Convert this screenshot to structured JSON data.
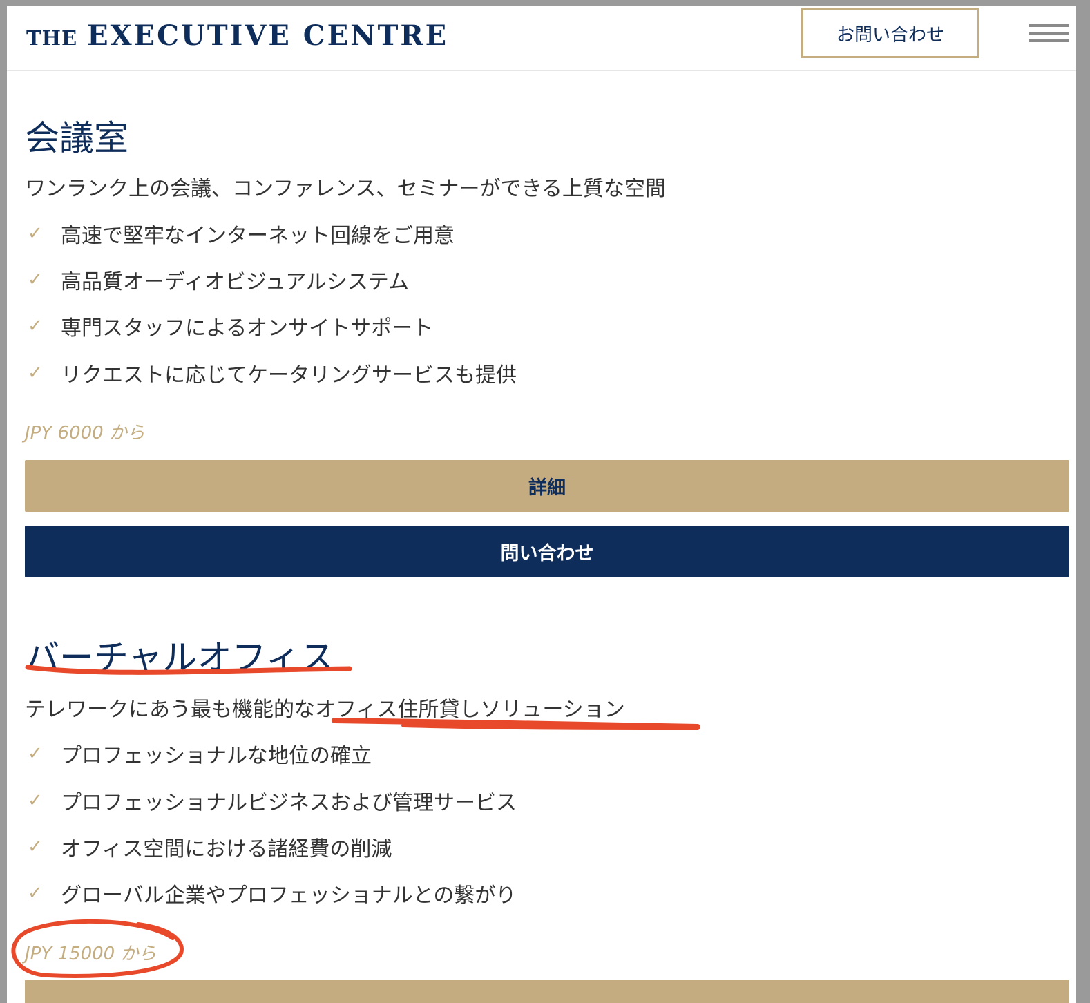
{
  "header": {
    "logo_the": "THE",
    "logo_main": "EXECUTIVE CENTRE",
    "contact_label": "お問い合わせ"
  },
  "meeting_room": {
    "title": "会議室",
    "subtitle": "ワンランク上の会議、コンファレンス、セミナーができる上質な空間",
    "features": [
      "高速で堅牢なインターネット回線をご用意",
      "高品質オーディオビジュアルシステム",
      "専門スタッフによるオンサイトサポート",
      "リクエストに応じてケータリングサービスも提供"
    ],
    "price": "JPY 6000 から",
    "detail_label": "詳細",
    "contact_label": "問い合わせ"
  },
  "virtual_office": {
    "title": "バーチャルオフィス",
    "subtitle": "テレワークにあう最も機能的なオフィス住所貸しソリューション",
    "features": [
      "プロフェッショナルな地位の確立",
      "プロフェッショナルビジネスおよび管理サービス",
      "オフィス空間における諸経費の削減",
      "グローバル企業やプロフェッショナルとの繋がり"
    ],
    "price": "JPY 15000 から"
  },
  "check_symbol": "✓",
  "colors": {
    "navy": "#0f2d5b",
    "gold": "#c4ab80",
    "annotation_red": "#e8492a"
  }
}
